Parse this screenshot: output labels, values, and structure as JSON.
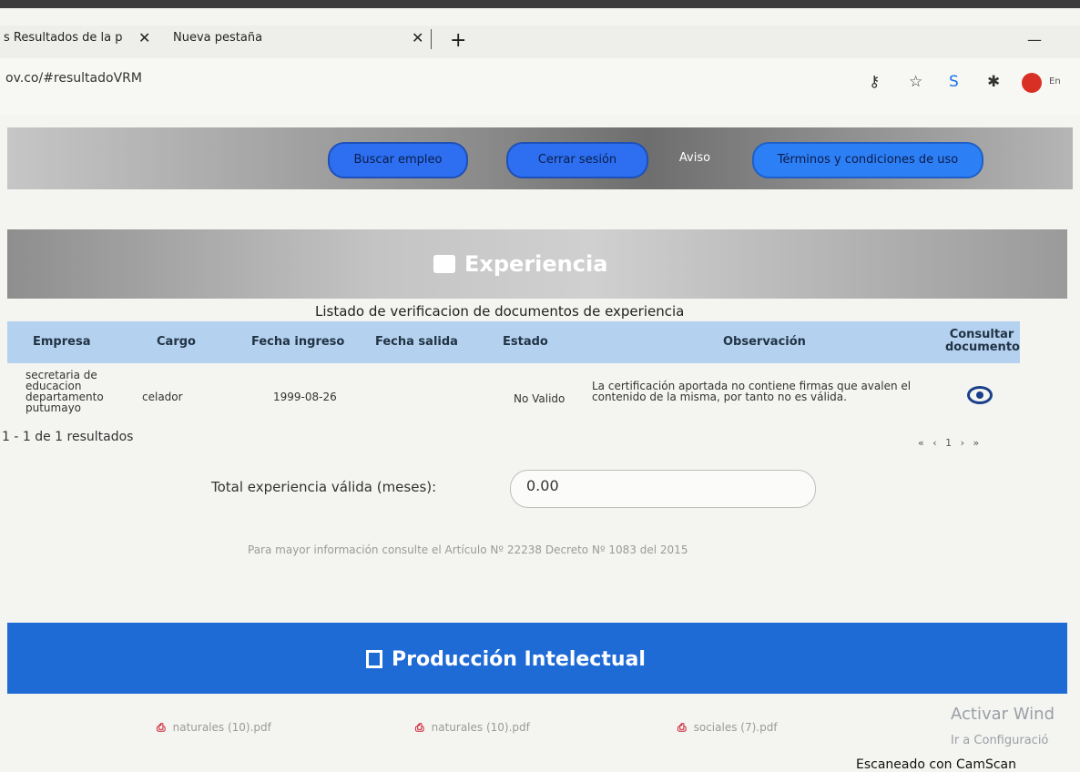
{
  "browser": {
    "tabs": [
      {
        "label": "s Resultados de la p"
      },
      {
        "label": "Nueva pestaña"
      }
    ],
    "url": "ov.co/#resultadoVRM",
    "profile_letter": "",
    "lang": "En"
  },
  "navbar": {
    "buscar": "Buscar empleo",
    "cerrar": "Cerrar sesión",
    "aviso": "Aviso",
    "terminos": "Términos y condiciones de uso"
  },
  "experiencia": {
    "title": "Experiencia",
    "list_title": "Listado de verificacion de documentos de experiencia",
    "columns": [
      "Empresa",
      "Cargo",
      "Fecha ingreso",
      "Fecha salida",
      "Estado",
      "Observación",
      "Consultar documento"
    ],
    "rows": [
      {
        "empresa": "secretaria de educacion departamento putumayo",
        "cargo": "celador",
        "fecha_ingreso": "1999-08-26",
        "fecha_salida": "",
        "estado": "No Valido",
        "observacion": "La certificación aportada no contiene firmas que avalen el contenido de la misma, por tanto no es válida."
      }
    ],
    "results_count": "1 - 1 de 1 resultados",
    "pager": "« ‹ 1 › »",
    "total_label": "Total experiencia válida (meses):",
    "total_value": "0.00",
    "info": "Para mayor información consulte el Artículo Nº 22238 Decreto Nº 1083 del 2015"
  },
  "produccion": {
    "title": "Producción Intelectual",
    "files": [
      "naturales (10).pdf",
      "naturales (10).pdf",
      "sociales (7).pdf"
    ]
  },
  "overlay": {
    "activar": "Activar Wind",
    "ir_config": "Ir a Configuració",
    "scanned": "Escaneado con CamScan"
  }
}
